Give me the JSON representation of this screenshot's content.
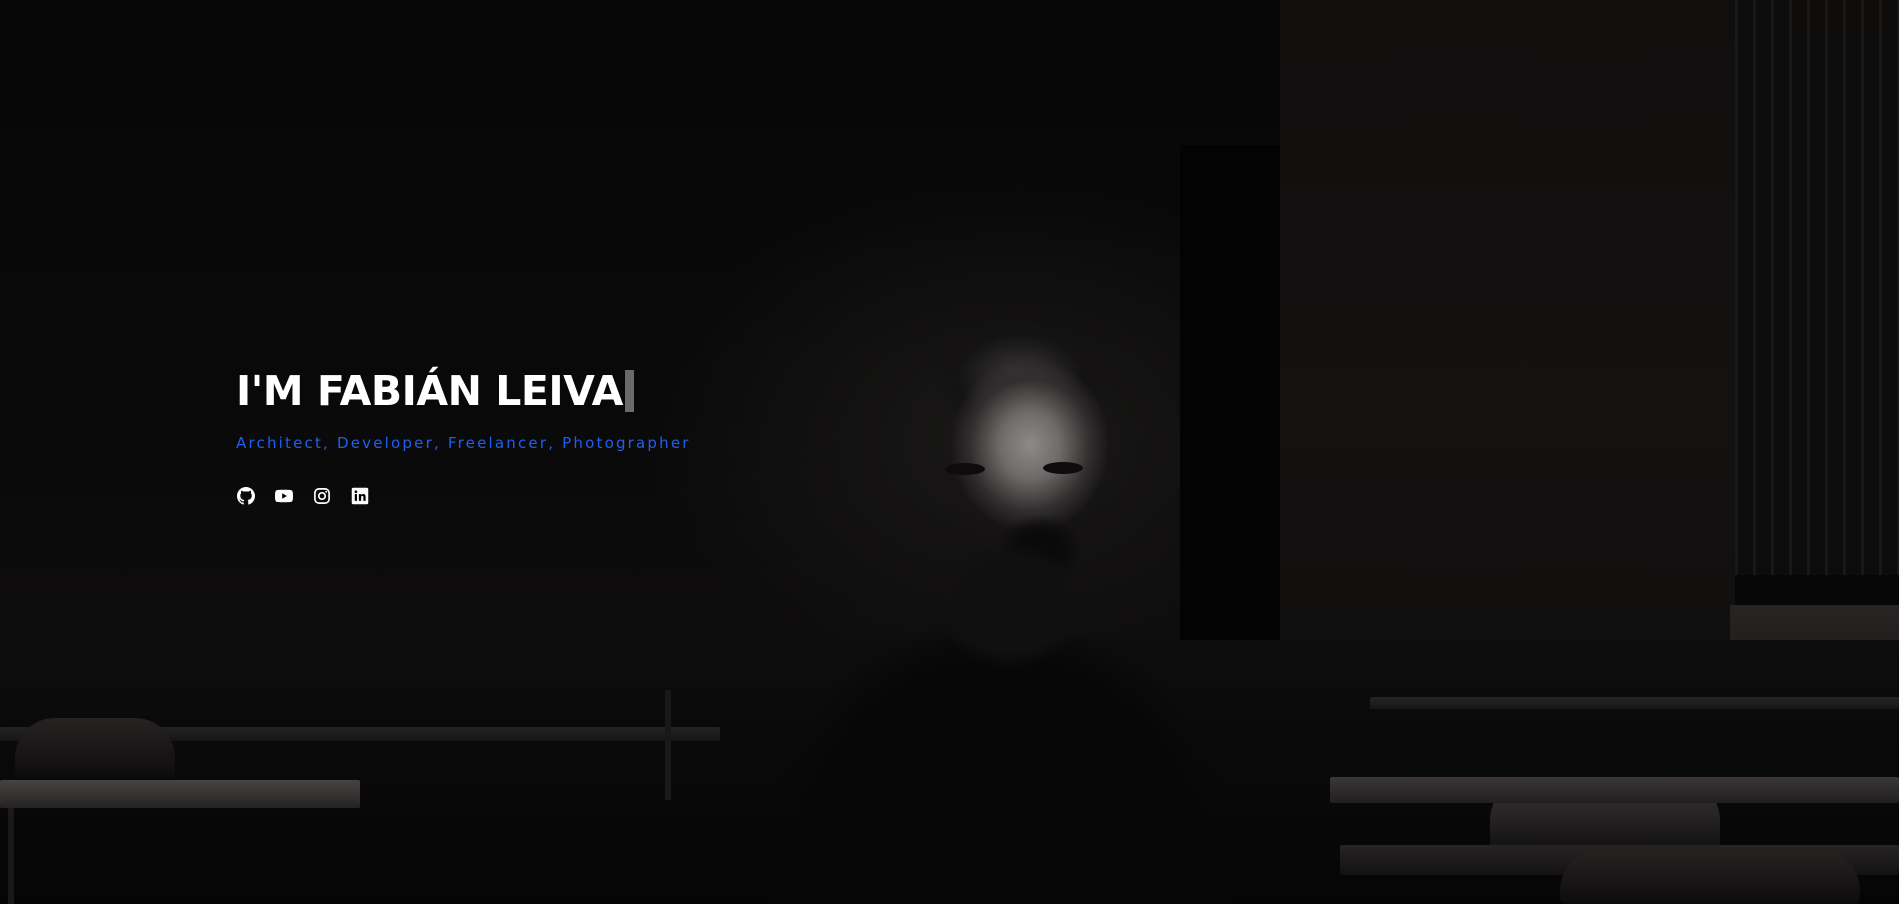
{
  "hero": {
    "title": "I'M FABIÁN LEIVA",
    "subtitle": "Architect, Developer, Freelancer, Photographer",
    "subtitle_color": "#1f5ff0",
    "title_color": "#ffffff",
    "caret_color": "#6a6a6a"
  },
  "socials": [
    {
      "icon": "github-icon"
    },
    {
      "icon": "youtube-icon"
    },
    {
      "icon": "instagram-icon"
    },
    {
      "icon": "linkedin-icon"
    }
  ]
}
